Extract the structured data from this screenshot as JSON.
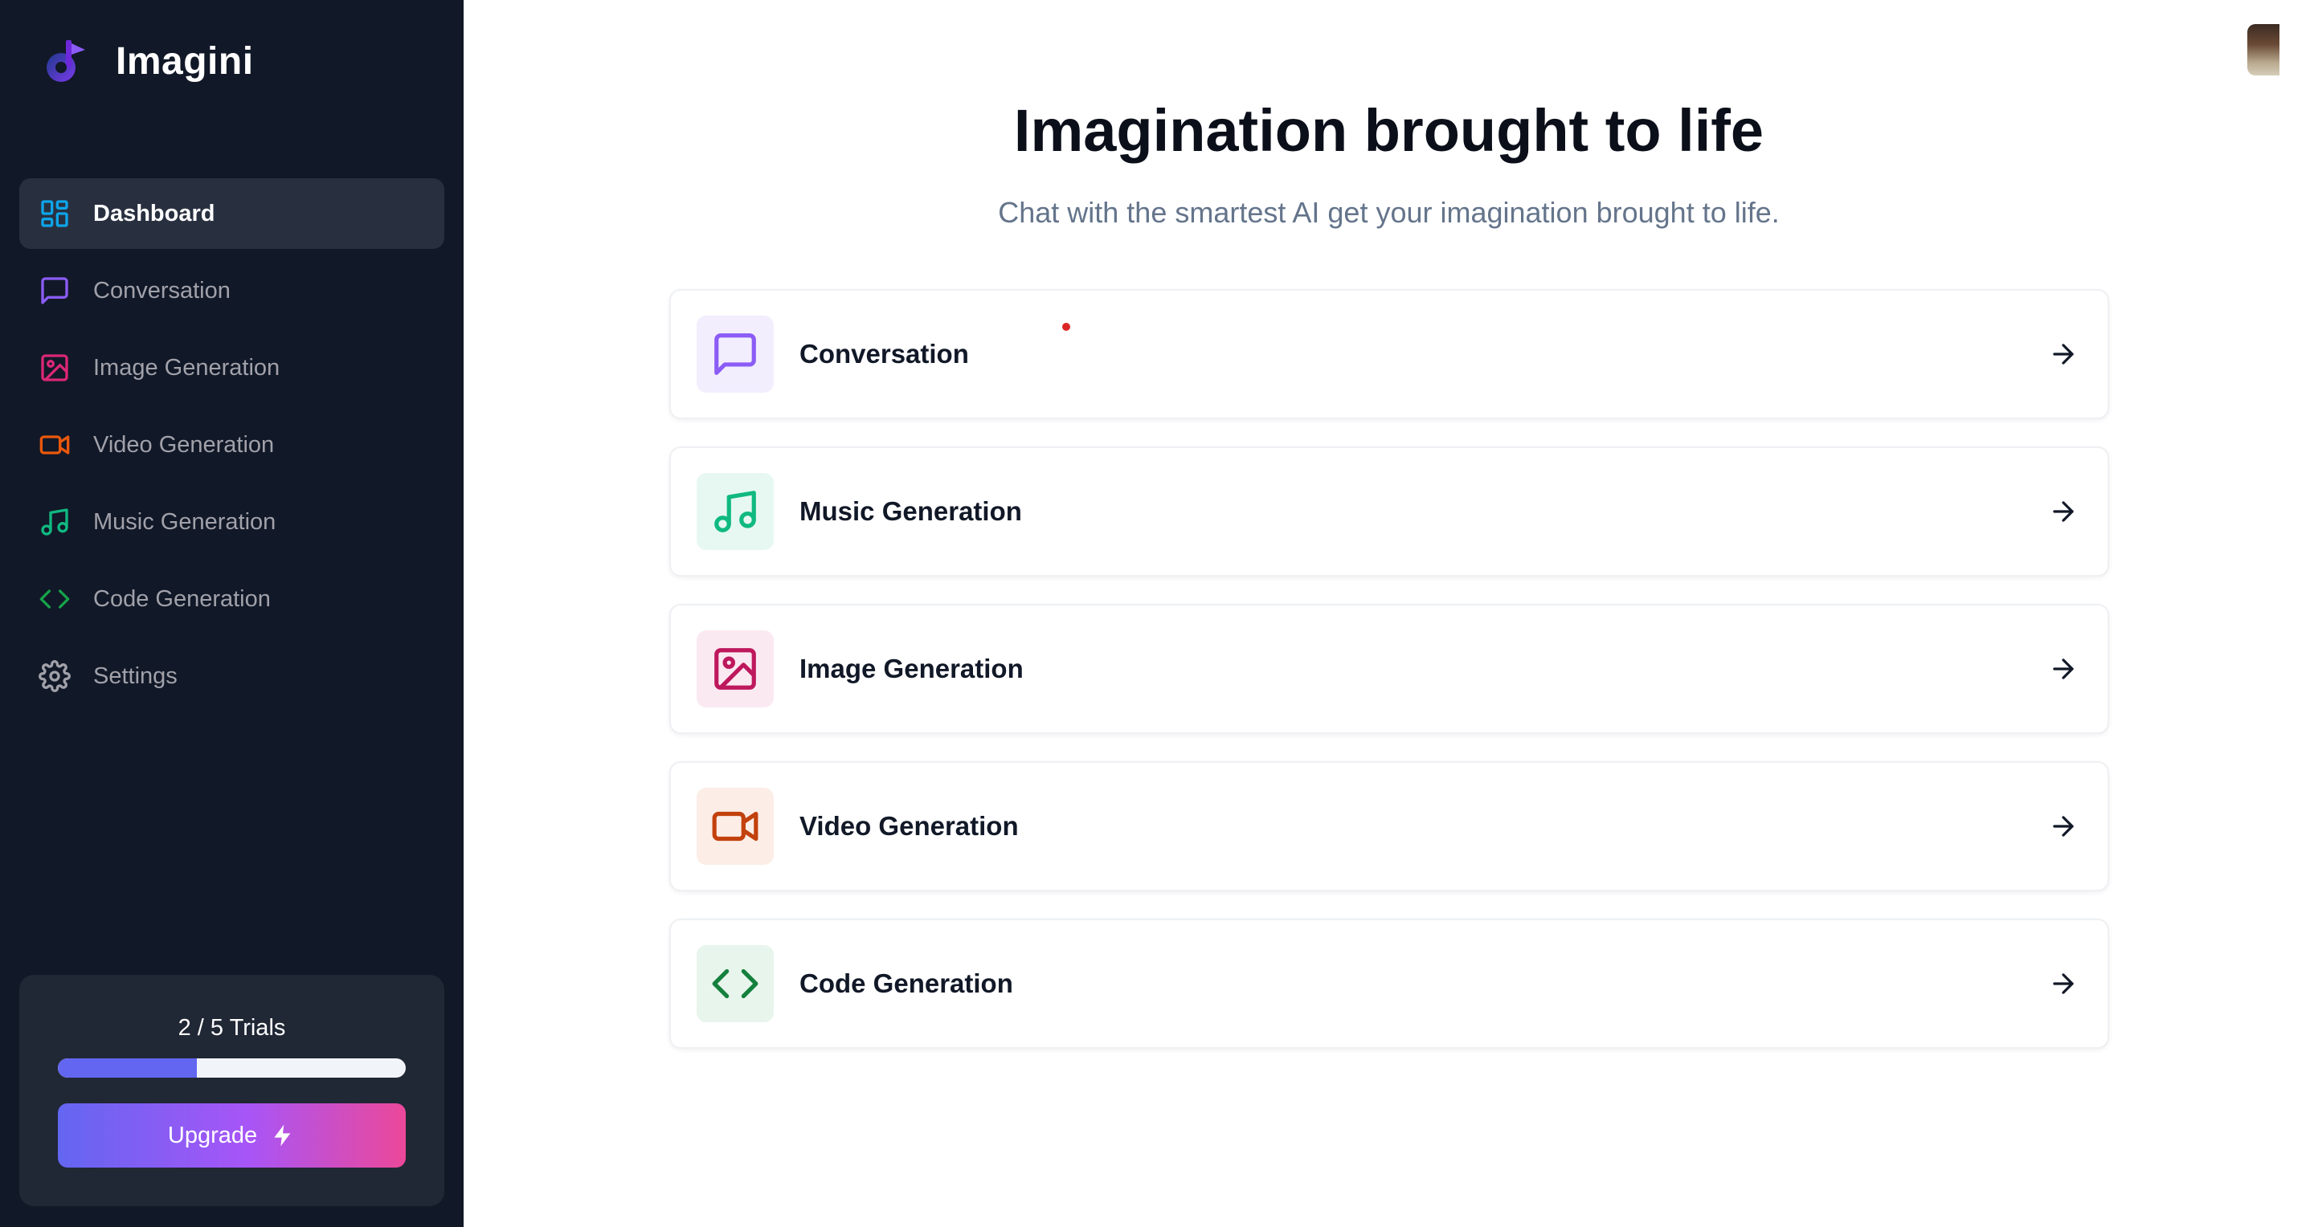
{
  "app": {
    "name": "Imagini"
  },
  "sidebar": {
    "items": [
      {
        "label": "Dashboard",
        "icon": "layout-dashboard-icon",
        "color": "#0ea5e9",
        "active": true
      },
      {
        "label": "Conversation",
        "icon": "message-square-icon",
        "color": "#8b5cf6",
        "active": false
      },
      {
        "label": "Image Generation",
        "icon": "image-icon",
        "color": "#db2777",
        "active": false
      },
      {
        "label": "Video Generation",
        "icon": "video-icon",
        "color": "#ea580c",
        "active": false
      },
      {
        "label": "Music Generation",
        "icon": "music-icon",
        "color": "#10b981",
        "active": false
      },
      {
        "label": "Code Generation",
        "icon": "code-icon",
        "color": "#16a34a",
        "active": false
      },
      {
        "label": "Settings",
        "icon": "settings-icon",
        "color": "#a1a1aa",
        "active": false
      }
    ],
    "trials": {
      "text": "2 / 5 Trials",
      "used": 2,
      "total": 5
    },
    "upgrade_label": "Upgrade"
  },
  "main": {
    "title": "Imagination brought to life",
    "subtitle": "Chat with the smartest AI get your imagination brought to life.",
    "tools": [
      {
        "label": "Conversation",
        "icon": "message-square-icon",
        "color": "#8b5cf6",
        "bg": "#f3eefe"
      },
      {
        "label": "Music Generation",
        "icon": "music-icon",
        "color": "#10b981",
        "bg": "#e7f8f2"
      },
      {
        "label": "Image Generation",
        "icon": "image-icon",
        "color": "#be185d",
        "bg": "#fbe9f1"
      },
      {
        "label": "Video Generation",
        "icon": "video-icon",
        "color": "#c2410c",
        "bg": "#fcede6"
      },
      {
        "label": "Code Generation",
        "icon": "code-icon",
        "color": "#15803d",
        "bg": "#e8f5ec"
      }
    ]
  },
  "colors": {
    "sidebar_bg": "#111827",
    "active_bg": "#283040",
    "progress_fill": "#6366f1",
    "upgrade_gradient": [
      "#6366f1",
      "#a855f7",
      "#ec4899"
    ]
  }
}
